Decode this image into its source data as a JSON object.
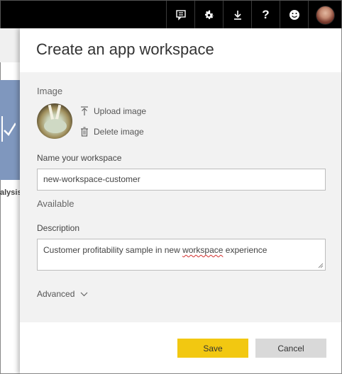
{
  "topbar": {
    "icons": [
      "feedback-icon",
      "gear-icon",
      "download-icon",
      "help-icon",
      "smiley-icon",
      "avatar"
    ],
    "help_label": "?"
  },
  "background": {
    "partial_text": "alysis"
  },
  "panel": {
    "title": "Create an app workspace",
    "image_section_label": "Image",
    "upload_label": "Upload image",
    "delete_label": "Delete image",
    "name_label": "Name your workspace",
    "name_value": "new-workspace-customer",
    "availability_text": "Available",
    "description_label": "Description",
    "description_before": "Customer profitability sample in new ",
    "description_misspelled": "workspace",
    "description_after": " experience",
    "advanced_label": "Advanced",
    "save_label": "Save",
    "cancel_label": "Cancel"
  },
  "colors": {
    "topbar": "#000000",
    "save_button": "#f2c811",
    "cancel_button": "#d9d9d9",
    "panel_body": "#f2f2f2",
    "tile": "#7f97be"
  }
}
